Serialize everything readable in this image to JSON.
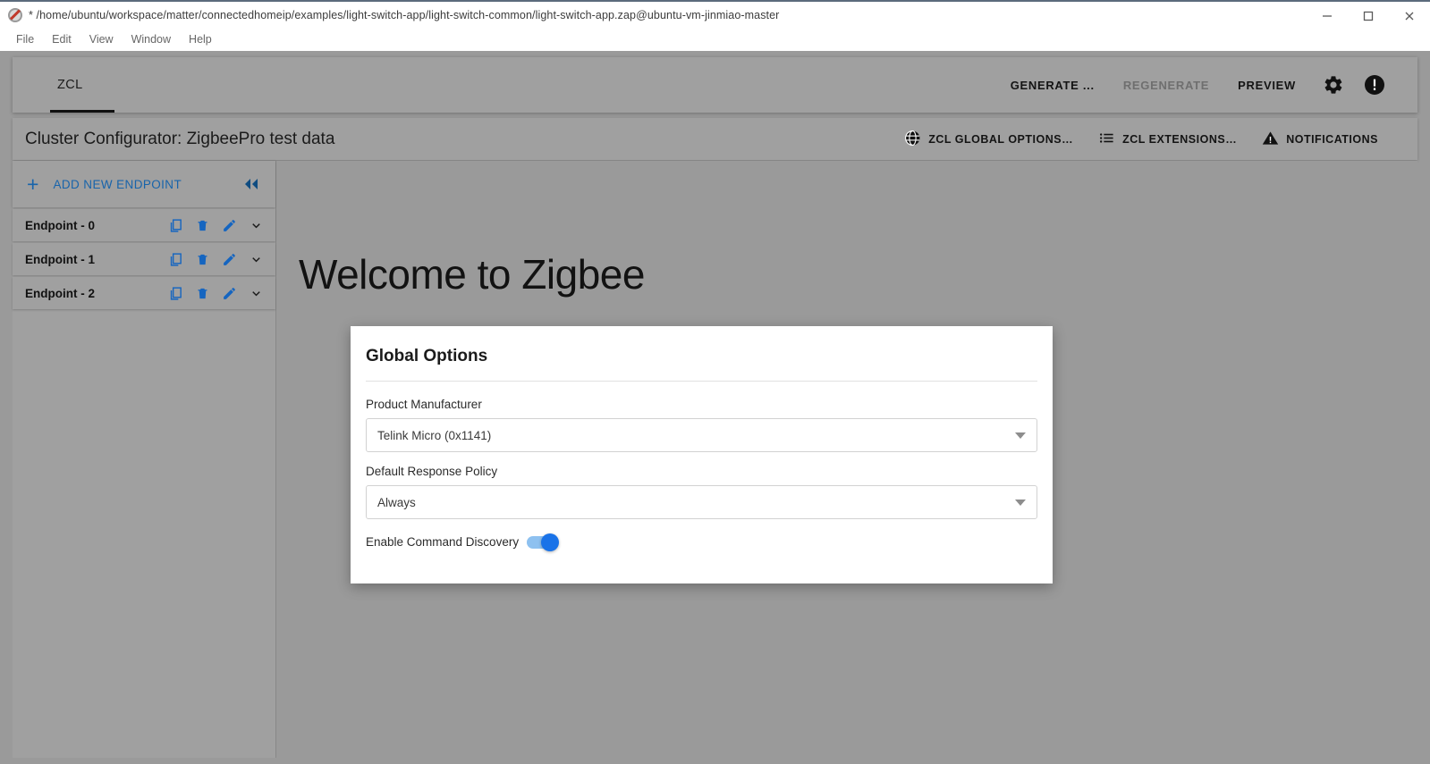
{
  "window": {
    "title": "* /home/ubuntu/workspace/matter/connectedhomeip/examples/light-switch-app/light-switch-common/light-switch-app.zap@ubuntu-vm-jinmiao-master",
    "app_icon": "blocked-circle-icon",
    "controls": {
      "minimize": "minimize-icon",
      "maximize": "maximize-icon",
      "close": "close-icon"
    }
  },
  "menubar": {
    "items": [
      {
        "label": "File"
      },
      {
        "label": "Edit"
      },
      {
        "label": "View"
      },
      {
        "label": "Window"
      },
      {
        "label": "Help"
      }
    ]
  },
  "toolbar": {
    "tab": {
      "label": "ZCL",
      "active": true
    },
    "actions": [
      {
        "label": "GENERATE ...",
        "disabled": false
      },
      {
        "label": "REGENERATE",
        "disabled": true
      },
      {
        "label": "PREVIEW",
        "disabled": false
      }
    ],
    "icons": [
      {
        "name": "gear-icon"
      },
      {
        "name": "exclamation-circle-icon"
      }
    ]
  },
  "header": {
    "title": "Cluster Configurator: ZigbeePro test data",
    "actions": [
      {
        "label": "ZCL GLOBAL OPTIONS…",
        "icon": "globe-icon"
      },
      {
        "label": "ZCL EXTENSIONS…",
        "icon": "list-icon"
      },
      {
        "label": "NOTIFICATIONS",
        "icon": "warning-triangle-icon"
      }
    ]
  },
  "sidebar": {
    "add_endpoint": {
      "plus": "+",
      "label": "ADD NEW ENDPOINT",
      "collapse_icon": "double-chevron-left-icon"
    },
    "endpoints": [
      {
        "label": "Endpoint - 0"
      },
      {
        "label": "Endpoint - 1"
      },
      {
        "label": "Endpoint - 2"
      }
    ],
    "row_icons": [
      {
        "name": "copy-icon"
      },
      {
        "name": "delete-icon"
      },
      {
        "name": "edit-icon"
      },
      {
        "name": "chevron-down-icon"
      }
    ]
  },
  "main": {
    "welcome_title": "Welcome to Zigbee"
  },
  "modal": {
    "title": "Global Options",
    "fields": [
      {
        "label": "Product Manufacturer",
        "value": "Telink Micro (0x1141)",
        "type": "select"
      },
      {
        "label": "Default Response Policy",
        "value": "Always",
        "type": "select"
      }
    ],
    "toggle": {
      "label": "Enable Command Discovery",
      "on": true
    }
  },
  "colors": {
    "accent_blue": "#1864ab",
    "toggle_on": "#1a73e8",
    "backdrop": "#9a9a9a",
    "panel": "#a0a0a0",
    "modal_bg": "#ffffff"
  }
}
